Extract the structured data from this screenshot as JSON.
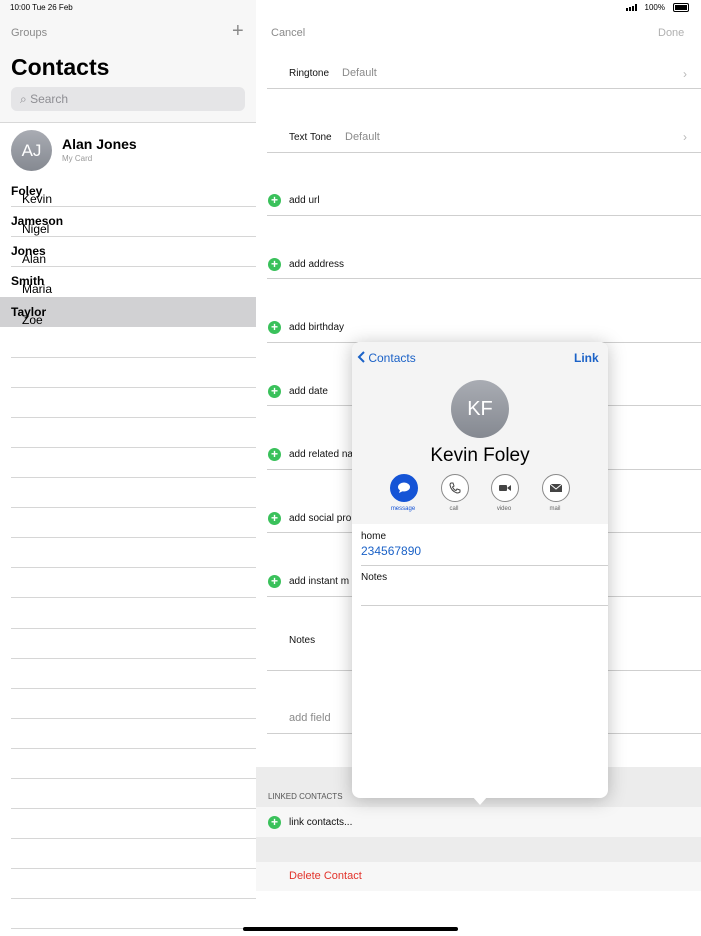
{
  "status": {
    "time": "10:00  Tue 26 Feb",
    "battery": "100%"
  },
  "sidebar": {
    "groups_label": "Groups",
    "add_icon": "plus-icon",
    "title": "Contacts",
    "search_placeholder": "Search",
    "my_card": {
      "initials": "AJ",
      "name": "Alan Jones",
      "subtitle": "My Card"
    },
    "contacts": [
      {
        "first": "Kevin",
        "last": "Foley"
      },
      {
        "first": "Nigel",
        "last": "Jameson"
      },
      {
        "first": "Alan",
        "last": "Jones"
      },
      {
        "first": "Maria",
        "last": "Smith"
      },
      {
        "first": "Zoe",
        "last": "Taylor",
        "selected": true
      }
    ]
  },
  "editor": {
    "cancel_label": "Cancel",
    "done_label": "Done",
    "ringtone": {
      "label": "Ringtone",
      "value": "Default"
    },
    "texttone": {
      "label": "Text Tone",
      "value": "Default"
    },
    "add_rows": [
      "add url",
      "add address",
      "add birthday",
      "add date",
      "add related na",
      "add social pro",
      "add instant m"
    ],
    "notes_label": "Notes",
    "add_field_label": "add field",
    "linked_header": "LINKED CONTACTS",
    "link_contacts_label": "link contacts...",
    "delete_label": "Delete Contact"
  },
  "popover": {
    "back_label": "Contacts",
    "link_label": "Link",
    "initials": "KF",
    "name": "Kevin Foley",
    "actions": [
      {
        "label": "message",
        "icon": "message-icon"
      },
      {
        "label": "call",
        "icon": "phone-icon"
      },
      {
        "label": "video",
        "icon": "video-icon"
      },
      {
        "label": "mail",
        "icon": "mail-icon"
      }
    ],
    "phone_label": "home",
    "phone_value": "234567890",
    "notes_label": "Notes"
  },
  "colors": {
    "accent": "#1b62c7",
    "green": "#3ac15b",
    "delete": "#e2332b"
  }
}
